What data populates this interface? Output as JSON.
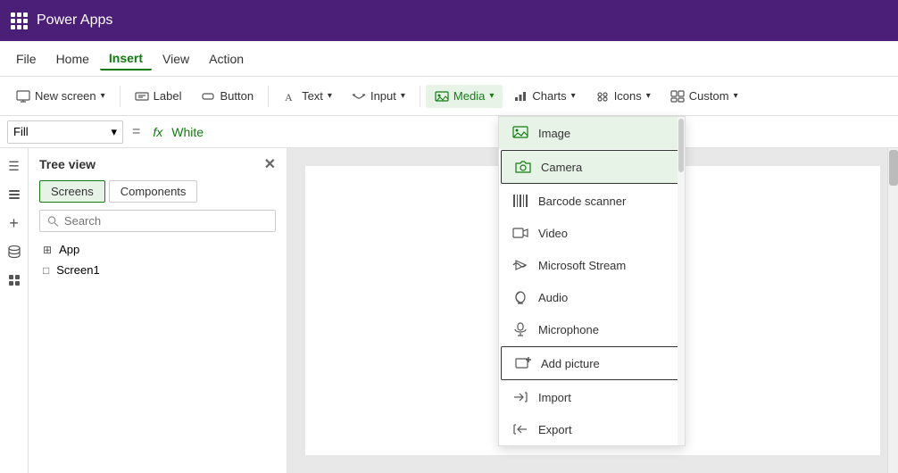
{
  "titlebar": {
    "app_name": "Power Apps"
  },
  "menubar": {
    "items": [
      {
        "id": "file",
        "label": "File"
      },
      {
        "id": "home",
        "label": "Home"
      },
      {
        "id": "insert",
        "label": "Insert",
        "active": true
      },
      {
        "id": "view",
        "label": "View"
      },
      {
        "id": "action",
        "label": "Action"
      }
    ]
  },
  "toolbar": {
    "new_screen_label": "New screen",
    "label_label": "Label",
    "button_label": "Button",
    "text_label": "Text",
    "input_label": "Input",
    "media_label": "Media",
    "charts_label": "Charts",
    "icons_label": "Icons",
    "custom_label": "Custom"
  },
  "formula_bar": {
    "property": "Fill",
    "value": "White"
  },
  "tree_view": {
    "title": "Tree view",
    "tabs": [
      {
        "id": "screens",
        "label": "Screens",
        "active": true
      },
      {
        "id": "components",
        "label": "Components",
        "active": false
      }
    ],
    "search_placeholder": "Search",
    "items": [
      {
        "id": "app",
        "label": "App",
        "icon": "⊞"
      },
      {
        "id": "screen1",
        "label": "Screen1",
        "icon": "□"
      }
    ]
  },
  "media_dropdown": {
    "items": [
      {
        "id": "image",
        "label": "Image",
        "icon": "🖼",
        "highlighted": true
      },
      {
        "id": "camera",
        "label": "Camera",
        "icon": "📷",
        "highlighted": true,
        "outlined": true
      },
      {
        "id": "barcode",
        "label": "Barcode scanner",
        "icon": "▦"
      },
      {
        "id": "video",
        "label": "Video",
        "icon": "▶"
      },
      {
        "id": "ms-stream",
        "label": "Microsoft Stream",
        "icon": "◎"
      },
      {
        "id": "audio",
        "label": "Audio",
        "icon": "🎧"
      },
      {
        "id": "microphone",
        "label": "Microphone",
        "icon": "🎤"
      },
      {
        "id": "add-picture",
        "label": "Add picture",
        "icon": "🖼",
        "outlined": true
      },
      {
        "id": "import",
        "label": "Import",
        "icon": "←"
      },
      {
        "id": "export",
        "label": "Export",
        "icon": "→"
      }
    ]
  },
  "left_sidebar": {
    "icons": [
      {
        "id": "menu",
        "symbol": "☰"
      },
      {
        "id": "layers",
        "symbol": "⊞"
      },
      {
        "id": "add",
        "symbol": "+"
      },
      {
        "id": "data",
        "symbol": "🗄"
      },
      {
        "id": "components2",
        "symbol": "⁞⁞"
      }
    ]
  }
}
